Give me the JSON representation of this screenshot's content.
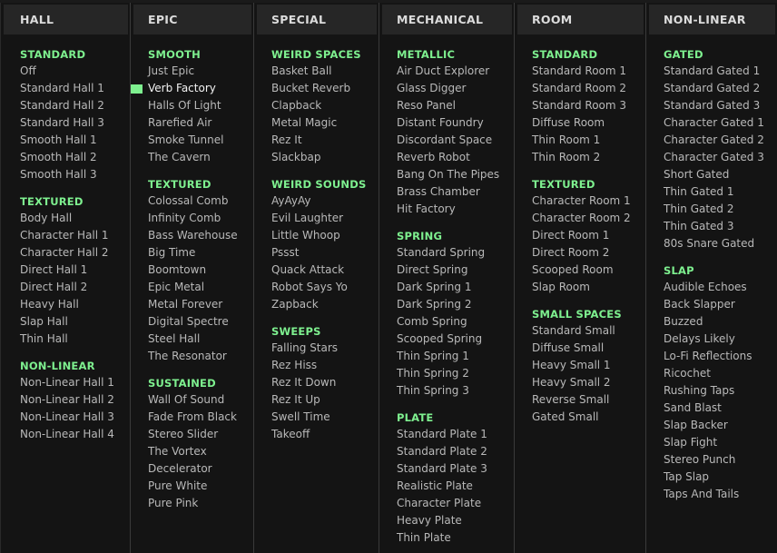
{
  "accent_color": "#7ef08f",
  "selected_preset": "Verb Factory",
  "columns": [
    {
      "title": "HALL",
      "sections": [
        {
          "title": "STANDARD",
          "items": [
            "Off",
            "Standard Hall 1",
            "Standard Hall 2",
            "Standard Hall 3",
            "Smooth Hall 1",
            "Smooth Hall 2",
            "Smooth Hall 3"
          ]
        },
        {
          "title": "TEXTURED",
          "items": [
            "Body Hall",
            "Character Hall 1",
            "Character Hall 2",
            "Direct Hall 1",
            "Direct Hall 2",
            "Heavy Hall",
            "Slap Hall",
            "Thin Hall"
          ]
        },
        {
          "title": "NON-LINEAR",
          "items": [
            "Non-Linear Hall 1",
            "Non-Linear Hall 2",
            "Non-Linear Hall 3",
            "Non-Linear Hall 4"
          ]
        }
      ]
    },
    {
      "title": "EPIC",
      "sections": [
        {
          "title": "SMOOTH",
          "items": [
            "Just Epic",
            "Verb Factory",
            "Halls Of Light",
            "Rarefied Air",
            "Smoke Tunnel",
            "The Cavern"
          ]
        },
        {
          "title": "TEXTURED",
          "items": [
            "Colossal Comb",
            "Infinity Comb",
            "Bass Warehouse",
            "Big Time",
            "Boomtown",
            "Epic Metal",
            "Metal Forever",
            "Digital Spectre",
            "Steel Hall",
            "The Resonator"
          ]
        },
        {
          "title": "SUSTAINED",
          "items": [
            "Wall Of Sound",
            "Fade From Black",
            "Stereo Slider",
            "The Vortex",
            "Decelerator",
            "Pure White",
            "Pure Pink"
          ]
        }
      ]
    },
    {
      "title": "SPECIAL",
      "sections": [
        {
          "title": "WEIRD SPACES",
          "items": [
            "Basket Ball",
            "Bucket Reverb",
            "Clapback",
            "Metal Magic",
            "Rez It",
            "Slackbap"
          ]
        },
        {
          "title": "WEIRD SOUNDS",
          "items": [
            "AyAyAy",
            "Evil Laughter",
            "Little Whoop",
            "Pssst",
            "Quack Attack",
            "Robot Says Yo",
            "Zapback"
          ]
        },
        {
          "title": "SWEEPS",
          "items": [
            "Falling Stars",
            "Rez Hiss",
            "Rez It Down",
            "Rez It Up",
            "Swell Time",
            "Takeoff"
          ]
        }
      ]
    },
    {
      "title": "MECHANICAL",
      "sections": [
        {
          "title": "METALLIC",
          "items": [
            "Air Duct Explorer",
            "Glass Digger",
            "Reso Panel",
            "Distant Foundry",
            "Discordant Space",
            "Reverb Robot",
            "Bang On The Pipes",
            "Brass Chamber",
            "Hit Factory"
          ]
        },
        {
          "title": "SPRING",
          "items": [
            "Standard Spring",
            "Direct Spring",
            "Dark Spring 1",
            "Dark Spring 2",
            "Comb Spring",
            "Scooped Spring",
            "Thin Spring 1",
            "Thin Spring 2",
            "Thin Spring 3"
          ]
        },
        {
          "title": "PLATE",
          "items": [
            "Standard Plate 1",
            "Standard Plate 2",
            "Standard Plate 3",
            "Realistic Plate",
            "Character Plate",
            "Heavy Plate",
            "Thin Plate"
          ]
        }
      ]
    },
    {
      "title": "ROOM",
      "sections": [
        {
          "title": "STANDARD",
          "items": [
            "Standard Room 1",
            "Standard Room 2",
            "Standard Room 3",
            "Diffuse Room",
            "Thin Room 1",
            "Thin Room 2"
          ]
        },
        {
          "title": "TEXTURED",
          "items": [
            "Character Room 1",
            "Character Room 2",
            "Direct Room 1",
            "Direct Room 2",
            "Scooped Room",
            "Slap Room"
          ]
        },
        {
          "title": "SMALL SPACES",
          "items": [
            "Standard Small",
            "Diffuse Small",
            "Heavy Small 1",
            "Heavy Small 2",
            "Reverse Small",
            "Gated Small"
          ]
        }
      ]
    },
    {
      "title": "NON-LINEAR",
      "sections": [
        {
          "title": "GATED",
          "items": [
            "Standard Gated 1",
            "Standard Gated 2",
            "Standard Gated 3",
            "Character Gated 1",
            "Character Gated 2",
            "Character Gated 3",
            "Short Gated",
            "Thin Gated 1",
            "Thin Gated 2",
            "Thin Gated 3",
            "80s Snare Gated"
          ]
        },
        {
          "title": "SLAP",
          "items": [
            "Audible Echoes",
            "Back Slapper",
            "Buzzed",
            "Delays Likely",
            "Lo-Fi Reflections",
            "Ricochet",
            "Rushing Taps",
            "Sand Blast",
            "Slap Backer",
            "Slap Fight",
            "Stereo Punch",
            "Tap Slap",
            "Taps And Tails"
          ]
        }
      ]
    }
  ]
}
